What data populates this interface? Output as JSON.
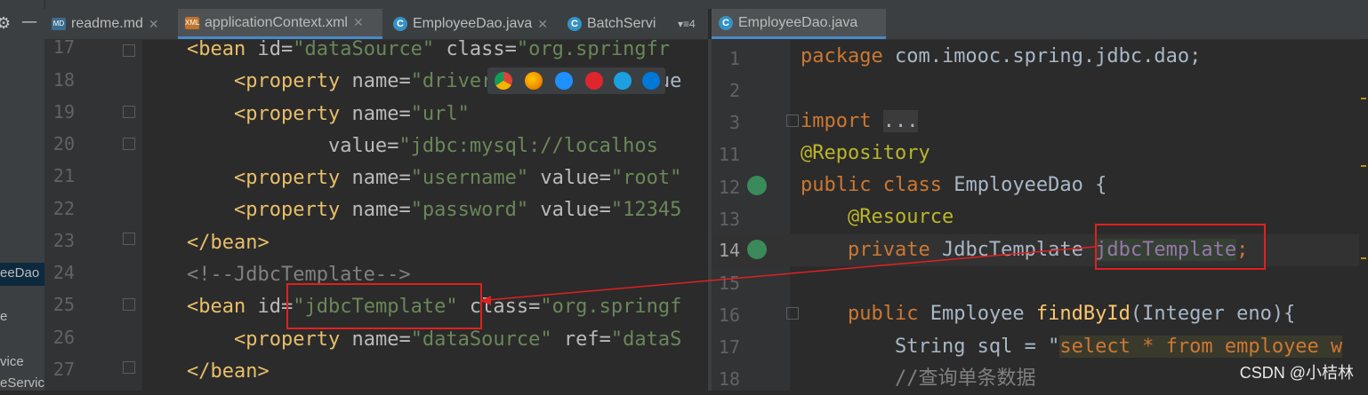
{
  "project_panel": {
    "items": [
      {
        "label": "eeDao"
      },
      {
        "label": "e"
      },
      {
        "label": "vice"
      },
      {
        "label": "eServic"
      }
    ]
  },
  "left_tabs": [
    {
      "label": "readme.md",
      "icon": "markdown-file-icon"
    },
    {
      "label": "applicationContext.xml",
      "icon": "xml-file-icon",
      "active": true
    },
    {
      "label": "EmployeeDao.java",
      "icon": "java-class-icon"
    },
    {
      "label": "BatchServi",
      "icon": "java-class-icon"
    }
  ],
  "tab_overflow": "▾≡4",
  "right_tabs": [
    {
      "label": "EmployeeDao.java",
      "icon": "java-class-icon",
      "active": true
    }
  ],
  "left_editor": {
    "line_numbers": [
      "17",
      "18",
      "19",
      "20",
      "21",
      "22",
      "23",
      "24",
      "25",
      "26",
      "27"
    ],
    "lines": [
      [
        "<bean id=\"dataSource\" class=\"org.springfr"
      ],
      [
        "    <property name=\"drive",
        "rClassName\" value"
      ],
      [
        "    <property name=\"url\""
      ],
      [
        "            value=\"jdbc:mysql://localhos"
      ],
      [
        "    <property name=\"username\" value=\"root\""
      ],
      [
        "    <property name=\"password\" value=\"12345"
      ],
      [
        "</bean>"
      ],
      [
        "<!--JdbcTemplate-->"
      ],
      [
        "<bean id=\"jdbcTemplate\" class=\"org.springf"
      ],
      [
        "    <property name=\"dataSource\" ref=\"dataS"
      ],
      [
        "</bean>"
      ]
    ]
  },
  "right_editor": {
    "line_numbers": [
      "1",
      "2",
      "3",
      "11",
      "12",
      "13",
      "14",
      "15",
      "16",
      "17",
      "18"
    ],
    "code": {
      "l1_kw": "package",
      "l1_rest": " com.imooc.spring.jdbc.dao;",
      "l3_kw": "import",
      "l3_fold": "...",
      "l4_ann": "@Repository",
      "l5_kw": "public class",
      "l5_rest": " EmployeeDao {",
      "l6_ann": "@Resource",
      "l7_kw": "private",
      "l7_type": " JdbcTemplate ",
      "l7_field": "jdbcTemplate",
      "l7_semi": ";",
      "l9_kw": "public",
      "l9_type": " Employee ",
      "l9_fn": "findById",
      "l9_rest": "(Integer eno){",
      "l10_pre": "String sql = \"",
      "l10_str": "select * from employee w",
      "l11_cmt": "//查询单条数据"
    }
  },
  "watermark": "CSDN @小桔林",
  "colors": {
    "background": "#2b2b2b",
    "keyword": "#cc7832",
    "string": "#6a8759",
    "tag": "#e8bf6a",
    "annotation": "#bbb529",
    "field": "#9876aa",
    "highlight_box": "#e02020"
  }
}
